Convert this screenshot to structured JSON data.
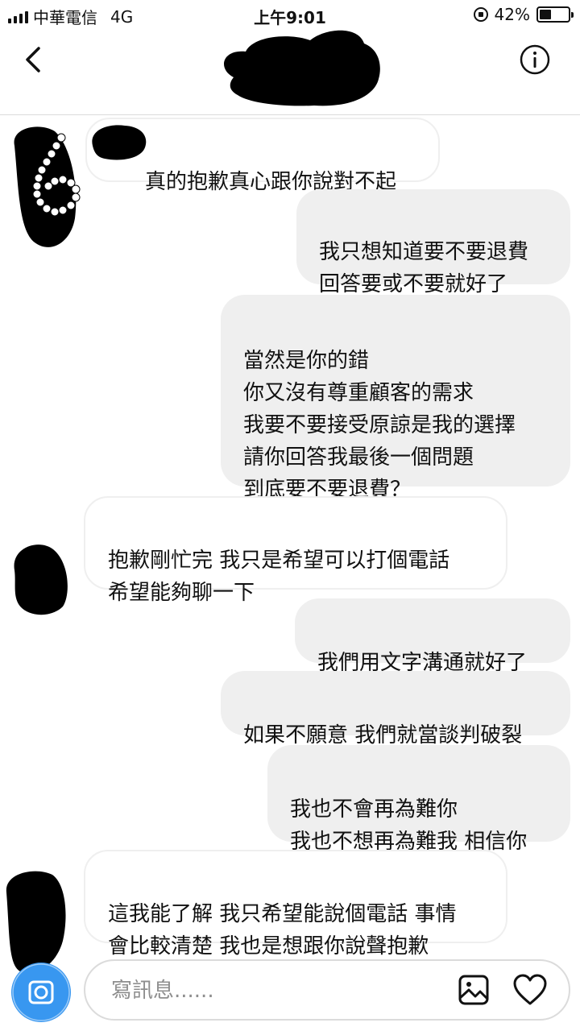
{
  "status_bar": {
    "carrier": "中華電信",
    "network": "4G",
    "time": "上午9:01",
    "battery": "42%",
    "battery_level": 0.42
  },
  "header": {
    "back_icon": "chevron-left-icon",
    "info_icon": "info-circle-icon"
  },
  "messages": [
    {
      "side": "in",
      "text": "真的抱歉真心跟你說對不起"
    },
    {
      "side": "out",
      "text": "我只想知道要不要退費\n回答要或不要就好了"
    },
    {
      "side": "out",
      "text": "當然是你的錯\n你又沒有尊重顧客的需求\n我要不要接受原諒是我的選擇\n請你回答我最後一個問題\n到底要不要退費？"
    },
    {
      "side": "in",
      "text": "抱歉剛忙完 我只是希望可以打個電話\n希望能夠聊一下"
    },
    {
      "side": "out",
      "text": "我們用文字溝通就好了"
    },
    {
      "side": "out",
      "text": "如果不願意 我們就當談判破裂"
    },
    {
      "side": "out",
      "text": "我也不會再為難你\n我也不想再為難我 相信你"
    },
    {
      "side": "in",
      "text": "這我能了解 我只希望能說個電話 事情\n會比較清楚 我也是想跟你說聲抱歉"
    }
  ],
  "composer": {
    "placeholder": "寫訊息......",
    "camera_icon": "camera-icon",
    "gallery_icon": "image-gallery-icon",
    "like_icon": "heart-icon"
  },
  "colors": {
    "outgoing_bubble": "#efefef",
    "incoming_border": "#efefef",
    "camera_button": "#3897f0",
    "divider": "#dbdbdb"
  }
}
